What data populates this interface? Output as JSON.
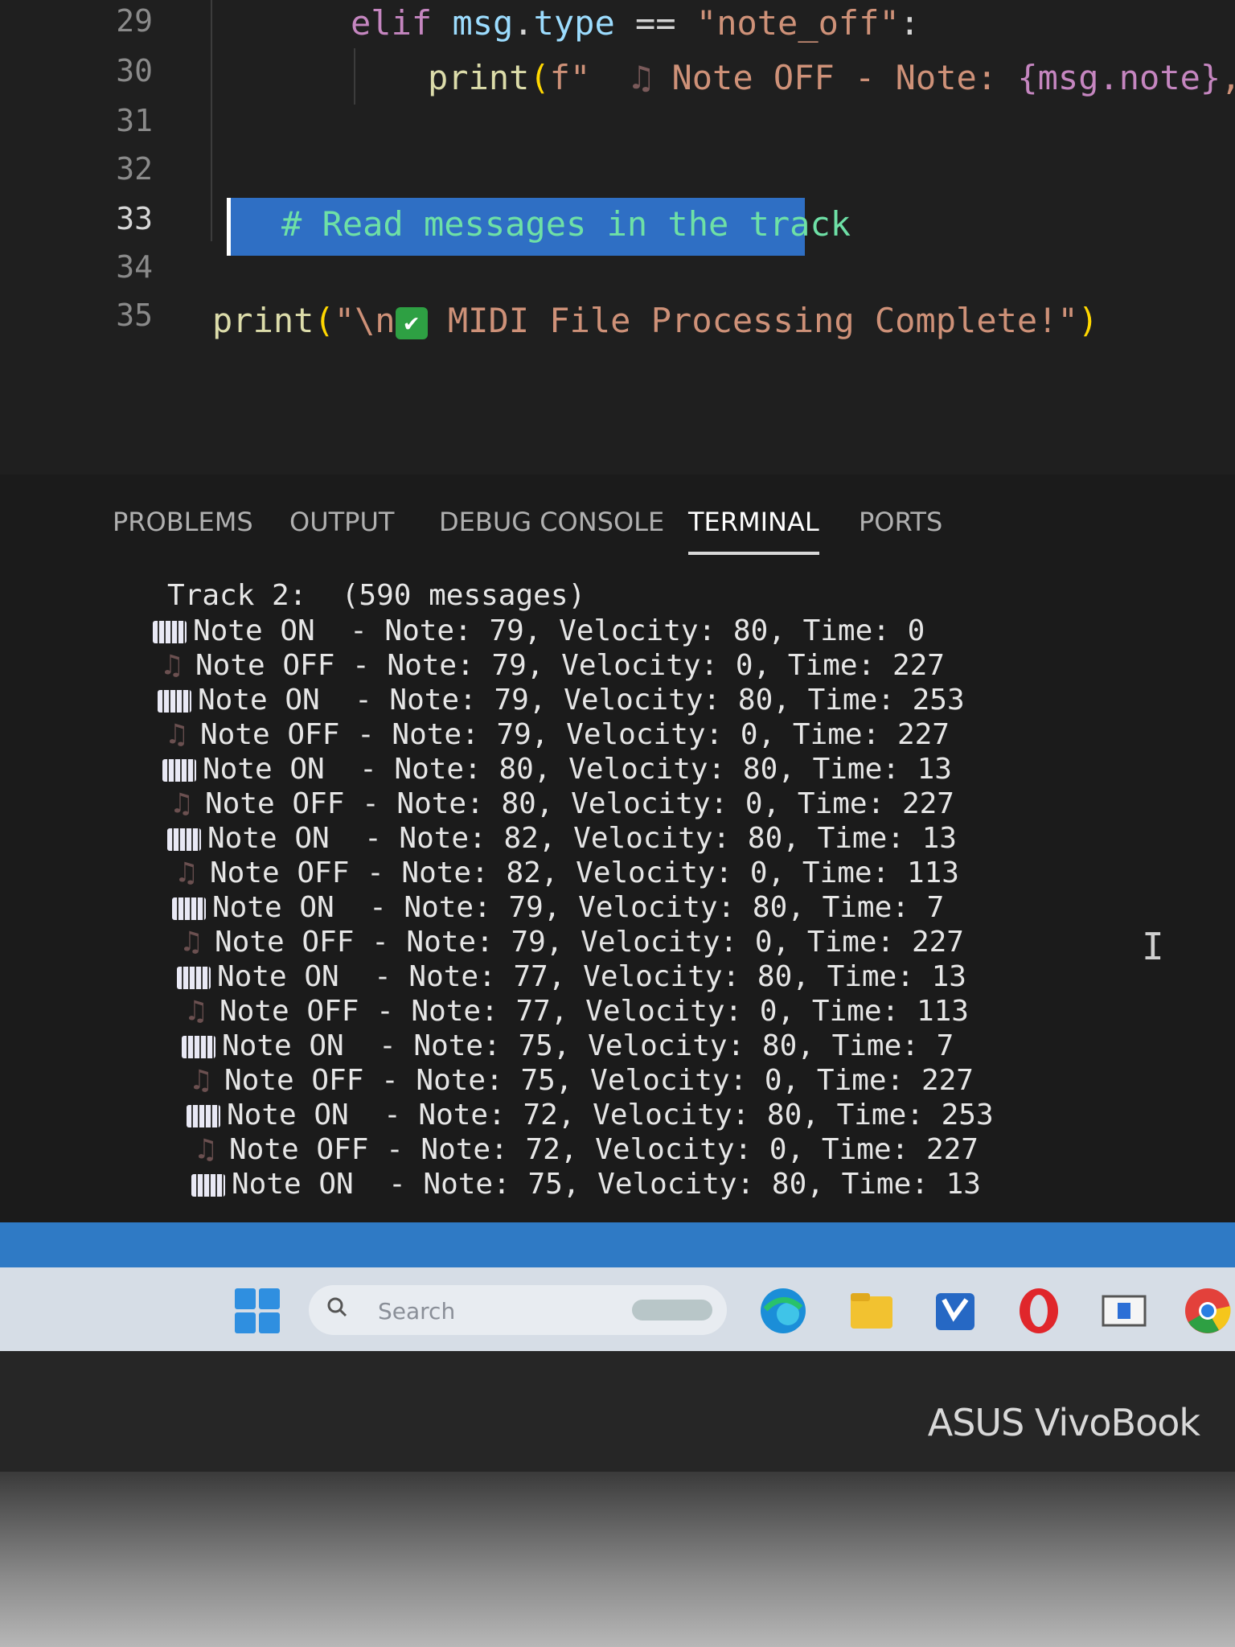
{
  "editor": {
    "line_numbers": [
      "29",
      "30",
      "31",
      "32",
      "33",
      "34",
      "35"
    ],
    "line29": {
      "kw": "elif ",
      "var1": "msg",
      "dot": ".",
      "var2": "type",
      "op": " == ",
      "str": "\"note_off\"",
      "colon": ":"
    },
    "line30": {
      "fn": "print",
      "paren": "(",
      "prefix": "f\"",
      "glyph": "♫",
      "str": " Note OFF - Note: ",
      "expr": "{msg.note}",
      "tail": ", V"
    },
    "line33_comment": "# Read messages in the track",
    "line35": {
      "fn": "print",
      "paren_open": "(",
      "str_start": "\"\\n",
      "check": "✔",
      "str_end": " MIDI File Processing Complete!\"",
      "paren_close": ")"
    }
  },
  "panel": {
    "tabs": [
      {
        "label": "PROBLEMS"
      },
      {
        "label": "OUTPUT"
      },
      {
        "label": "DEBUG CONSOLE"
      },
      {
        "label": "TERMINAL"
      },
      {
        "label": "PORTS"
      }
    ],
    "active_tab": "TERMINAL"
  },
  "terminal": {
    "header": "Track 2:  (590 messages)",
    "lines": [
      {
        "icon": "piano-icon",
        "text": "Note ON  - Note: 79, Velocity: 80, Time: 0"
      },
      {
        "icon": "music-note-icon",
        "text": "Note OFF - Note: 79, Velocity: 0, Time: 227"
      },
      {
        "icon": "piano-icon",
        "text": "Note ON  - Note: 79, Velocity: 80, Time: 253"
      },
      {
        "icon": "music-note-icon",
        "text": "Note OFF - Note: 79, Velocity: 0, Time: 227"
      },
      {
        "icon": "piano-icon",
        "text": "Note ON  - Note: 80, Velocity: 80, Time: 13"
      },
      {
        "icon": "music-note-icon",
        "text": "Note OFF - Note: 80, Velocity: 0, Time: 227"
      },
      {
        "icon": "piano-icon",
        "text": "Note ON  - Note: 82, Velocity: 80, Time: 13"
      },
      {
        "icon": "music-note-icon",
        "text": "Note OFF - Note: 82, Velocity: 0, Time: 113"
      },
      {
        "icon": "piano-icon",
        "text": "Note ON  - Note: 79, Velocity: 80, Time: 7"
      },
      {
        "icon": "music-note-icon",
        "text": "Note OFF - Note: 79, Velocity: 0, Time: 227"
      },
      {
        "icon": "piano-icon",
        "text": "Note ON  - Note: 77, Velocity: 80, Time: 13"
      },
      {
        "icon": "music-note-icon",
        "text": "Note OFF - Note: 77, Velocity: 0, Time: 113"
      },
      {
        "icon": "piano-icon",
        "text": "Note ON  - Note: 75, Velocity: 80, Time: 7"
      },
      {
        "icon": "music-note-icon",
        "text": "Note OFF - Note: 75, Velocity: 0, Time: 227"
      },
      {
        "icon": "piano-icon",
        "text": "Note ON  - Note: 72, Velocity: 80, Time: 253"
      },
      {
        "icon": "music-note-icon",
        "text": "Note OFF - Note: 72, Velocity: 0, Time: 227"
      },
      {
        "icon": "piano-icon",
        "text": "Note ON  - Note: 75, Velocity: 80, Time: 13"
      }
    ]
  },
  "taskbar": {
    "search_placeholder": "Search",
    "apps": [
      "windows-start-icon",
      "edge-icon",
      "file-explorer-icon",
      "store-icon",
      "opera-icon",
      "app-window-icon",
      "chrome-icon"
    ]
  },
  "bezel": {
    "brand": "ASUS VivoBook"
  },
  "colors": {
    "statusbar": "#2f7ac5",
    "comment_highlight": "#2f6fc4",
    "comment_text": "#6ee0a6",
    "keyword": "#c586c0",
    "string": "#ce9178",
    "variable": "#9cdcfe"
  }
}
